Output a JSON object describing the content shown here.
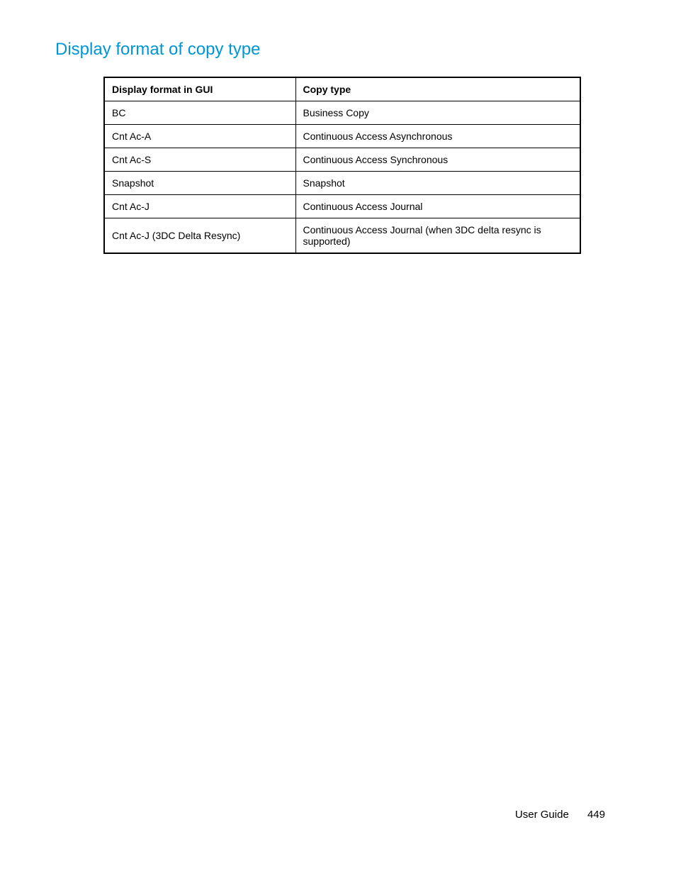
{
  "heading": "Display format of copy type",
  "table": {
    "headers": {
      "col1": "Display format in GUI",
      "col2": "Copy type"
    },
    "rows": [
      {
        "col1": "BC",
        "col2": "Business Copy"
      },
      {
        "col1": "Cnt Ac-A",
        "col2": "Continuous Access Asynchronous"
      },
      {
        "col1": "Cnt Ac-S",
        "col2": "Continuous Access Synchronous"
      },
      {
        "col1": "Snapshot",
        "col2": "Snapshot"
      },
      {
        "col1": "Cnt Ac-J",
        "col2": "Continuous Access Journal"
      },
      {
        "col1": "Cnt Ac-J (3DC Delta Resync)",
        "col2": "Continuous Access Journal (when 3DC delta resync is supported)"
      }
    ]
  },
  "footer": {
    "label": "User Guide",
    "page": "449"
  }
}
